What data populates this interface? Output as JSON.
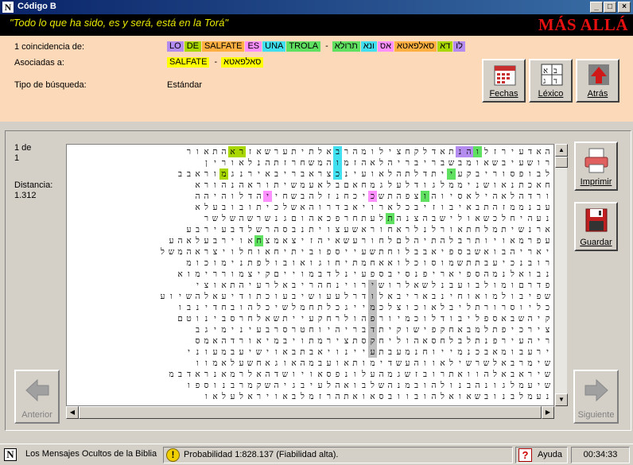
{
  "window": {
    "title": "Código B"
  },
  "header": {
    "quote": "\"Todo lo que ha sido, es y será, está en la Torá\"",
    "brand": "MÁS ALLÁ"
  },
  "info": {
    "match_label": "1 coincidencia de:",
    "spanish_terms": [
      {
        "text": "LO",
        "color": "#b48cf0"
      },
      {
        "text": "DE",
        "color": "#a8d800"
      },
      {
        "text": "SALFATE",
        "color": "#ffb040"
      },
      {
        "text": "ES",
        "color": "#ff90ff"
      },
      {
        "text": "UNA",
        "color": "#40e0f0"
      },
      {
        "text": "TROLA",
        "color": "#60e060"
      }
    ],
    "separator": "-",
    "hebrew_terms": [
      {
        "text": "תרולא",
        "color": "#60e060"
      },
      {
        "text": "ונא",
        "color": "#40e0f0"
      },
      {
        "text": "אס",
        "color": "#ff90ff"
      },
      {
        "text": "סאלפאטא",
        "color": "#ffb040"
      },
      {
        "text": "דא",
        "color": "#a8d800"
      },
      {
        "text": "לו",
        "color": "#b48cf0"
      }
    ],
    "associated_label": "Asociadas a:",
    "associated_terms": [
      {
        "text": "SALFATE",
        "color": "#ffff00"
      },
      {
        "text": "סאלפאטא",
        "color": "#ffff00"
      }
    ],
    "search_type_label": "Tipo de búsqueda:",
    "search_type_value": "Estándar"
  },
  "toolbar": {
    "dates": "Fechas",
    "lexicon": "Léxico",
    "back": "Atrás"
  },
  "side": {
    "match_index": "1 de",
    "match_total": "1",
    "distance_label": "Distancia:",
    "distance_value": "1.312",
    "print": "Imprimir",
    "save": "Guardar",
    "previous": "Anterior",
    "next": "Siguiente"
  },
  "grid": {
    "rows": [
      "האדעירזלוהנתאדלקחצילומהרבאלתיתערשאזראהתאור",
      "רושעיבשאומבשבריבריהלאהזמוהמשחרזתהנלאורין",
      "לבופסוריבקעייתדלתהלאועינכצראבריבאירנגמוראבב",
      "חאכתנאושניממלגודלעלגמחאםבלאעמשיתוראהנהורא",
      "ורדהלאהילאסיוהוצפהתשכיכחנזלהבשחייהדלוהיהה",
      "עבנממזהתבאיבוזיבכלארויאבדרוהאשלכיתובובעלא",
      "נעהיחלכשאולישבהצנהתלעתחרפכאהוםגנשרשהשלשר",
      "ארנשיתמלחתאורלנלראחוראשעצויתנבסהרשלדבעירבע",
      "עפרמאויותרבלהתיהלםלחורעשאיהזיצאמצחאוירבעלאהע",
      "יאריהבואשבספיאבבלוחתשעייספוביתיחאוחלויצראהמשל",
      "רובנכיעבתתשמוסוכלואאחמתיחוגואובולפתנימוכומ",
      "נבואלנמהספיאריפנסיבספעינלדבמוייםקיצמוררימוא",
      "פדרםומולבועבנלשאלרושירוינחהריבאלרעיהתאוצי",
      "שפיבולמואוחינבאריבאלודרלעעושיבעוכתודיעאלהשיוע",
      "כליוסרורתליבלאוכוצלכמייגכלתחמלשיכלהובחדינבו",
      "קיהשבאספליבודלוכמיורפהולרחקעייתשאלחרסבינוטם",
      "צירכיפתלמבאחקפישוקיתדבריהיוחטרסרבעינימיגב",
      "ריהעירפנתלבלחסאהוליחקסתצירמתויבמיאורדהאמס",
      "ירעבומאבכנמייוחנמעבתעיינויאבתבאוישיעבמעוני",
      "שימרבאלשרשילאווהעשדימותאועבמהאוגאחשעלאמוו",
      "שיראבאלהוואתרובזשגמהעלונפסאויושדהאלרמאנראדבמ",
      "שיעמלגונהבנולהובמנהשלבואהלעיבגיהשקמרבנוספו",
      "נעמלבנובשאואלהובוובסאואתהרזמלבאויראלעלאו"
    ],
    "highlights": [
      {
        "row": 0,
        "col": 10,
        "color": "#b48cf0"
      },
      {
        "row": 0,
        "col": 9,
        "color": "#b48cf0"
      },
      {
        "row": 0,
        "col": 8,
        "color": "#60e060"
      },
      {
        "row": 0,
        "col": 24,
        "color": "#40e0f0"
      },
      {
        "row": 0,
        "col": 35,
        "color": "#a8d800"
      },
      {
        "row": 0,
        "col": 36,
        "color": "#a8d800"
      },
      {
        "row": 1,
        "col": 24,
        "color": "#40e0f0"
      },
      {
        "row": 2,
        "col": 24,
        "color": "#40e0f0"
      },
      {
        "row": 2,
        "col": 11,
        "color": "#60e060"
      },
      {
        "row": 2,
        "col": 37,
        "color": "#a8d800"
      },
      {
        "row": 4,
        "col": 14,
        "color": "#60e060"
      },
      {
        "row": 4,
        "col": 20,
        "color": "#ff90ff"
      },
      {
        "row": 4,
        "col": 32,
        "color": "#ff90ff"
      },
      {
        "row": 6,
        "col": 18,
        "color": "#60e060"
      },
      {
        "row": 8,
        "col": 33,
        "color": "#60e060"
      },
      {
        "row": 12,
        "col": 20,
        "color": "#c0c0c0"
      },
      {
        "row": 13,
        "col": 20,
        "color": "#c0c0c0"
      },
      {
        "row": 14,
        "col": 20,
        "color": "#c0c0c0"
      },
      {
        "row": 15,
        "col": 20,
        "color": "#c0c0c0"
      },
      {
        "row": 16,
        "col": 20,
        "color": "#c0c0c0"
      },
      {
        "row": 17,
        "col": 20,
        "color": "#c0c0c0"
      },
      {
        "row": 18,
        "col": 20,
        "color": "#c0c0c0"
      }
    ]
  },
  "status": {
    "app_name": "Los Mensajes Ocultos de la Biblia",
    "probability": "Probabilidad 1:828.137 (Fiabilidad alta).",
    "help": "Ayuda",
    "time": "00:34:33"
  },
  "colors": {
    "quote": "#e8e800",
    "brand": "#e61010",
    "info_bg": "#fcd9b8",
    "gray_highlight": "#c0c0c0"
  }
}
